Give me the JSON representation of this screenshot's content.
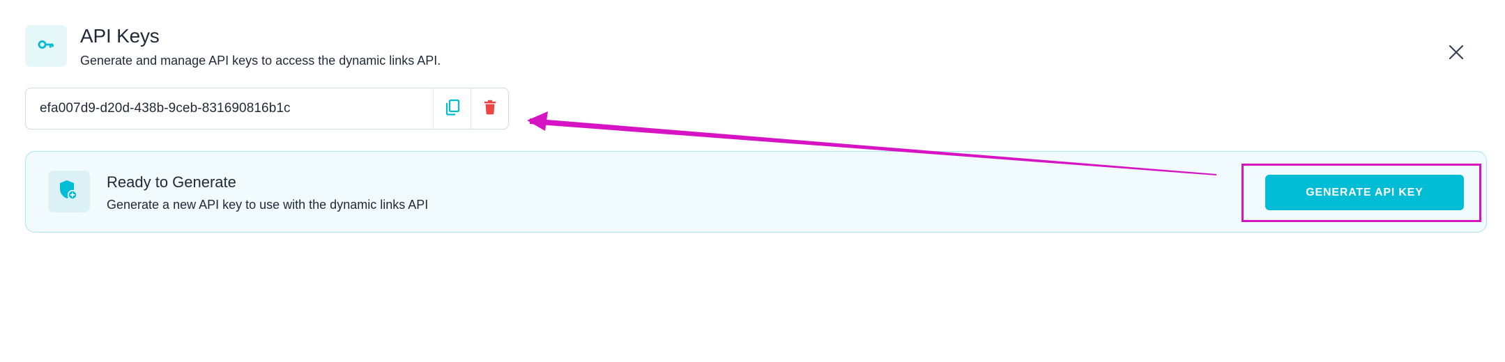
{
  "header": {
    "icon": "key-icon",
    "title": "API Keys",
    "subtitle": "Generate and manage API keys to access the dynamic links API.",
    "close_icon": "close-icon"
  },
  "api_key": {
    "value": "efa007d9-d20d-438b-9ceb-831690816b1c",
    "copy_icon": "copy-icon",
    "delete_icon": "trash-icon"
  },
  "ready_card": {
    "icon": "shield-plus-icon",
    "title": "Ready to Generate",
    "subtitle": "Generate a new API key to use with the dynamic links API",
    "button_label": "GENERATE API KEY"
  },
  "colors": {
    "accent": "#00bcd4",
    "danger": "#ef4444",
    "annotation": "#d614c4",
    "card_border": "#a9e4ee",
    "card_bg": "#f1fafc"
  }
}
